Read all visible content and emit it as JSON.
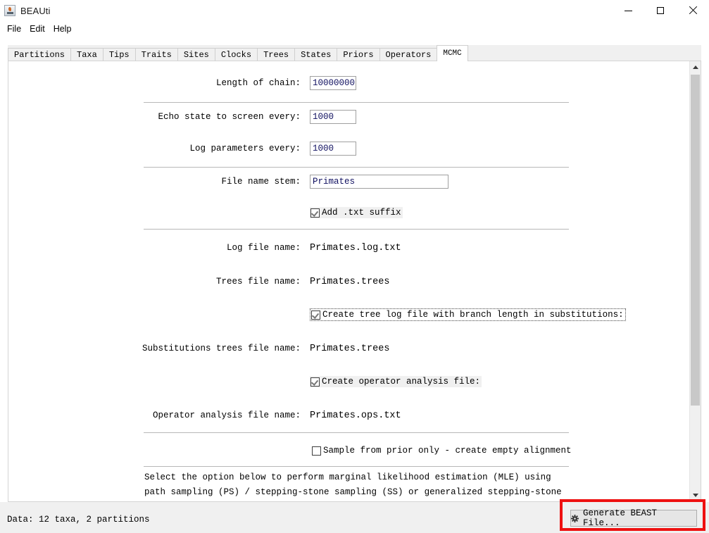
{
  "window": {
    "title": "BEAUti",
    "app_icon": "java-coffee-cup-icon",
    "controls": {
      "minimize": "minimize-icon",
      "maximize": "maximize-icon",
      "close": "close-icon"
    }
  },
  "menubar": {
    "items": [
      {
        "label": "File"
      },
      {
        "label": "Edit"
      },
      {
        "label": "Help"
      }
    ]
  },
  "tabs": [
    {
      "label": "Partitions",
      "active": false
    },
    {
      "label": "Taxa",
      "active": false
    },
    {
      "label": "Tips",
      "active": false
    },
    {
      "label": "Traits",
      "active": false
    },
    {
      "label": "Sites",
      "active": false
    },
    {
      "label": "Clocks",
      "active": false
    },
    {
      "label": "Trees",
      "active": false
    },
    {
      "label": "States",
      "active": false
    },
    {
      "label": "Priors",
      "active": false
    },
    {
      "label": "Operators",
      "active": false
    },
    {
      "label": "MCMC",
      "active": true
    }
  ],
  "form": {
    "length_of_chain": {
      "label": "Length of chain:",
      "value": "10000000"
    },
    "echo_state": {
      "label": "Echo state to screen every:",
      "value": "1000"
    },
    "log_parameters": {
      "label": "Log parameters every:",
      "value": "1000"
    },
    "file_name_stem": {
      "label": "File name stem:",
      "value": "Primates"
    },
    "add_txt_suffix": {
      "label": "Add .txt suffix",
      "checked": true
    },
    "log_file_name": {
      "label": "Log file name:",
      "value": "Primates.log.txt"
    },
    "trees_file_name": {
      "label": "Trees file name:",
      "value": "Primates.trees"
    },
    "create_tree_log_subs": {
      "label": "Create tree log file with branch length in substitutions:",
      "checked": true
    },
    "substitutions_trees_file_name": {
      "label": "Substitutions trees file name:",
      "value": "Primates.trees"
    },
    "create_operator_analysis": {
      "label": "Create operator analysis file:",
      "checked": true
    },
    "operator_analysis_file_name": {
      "label": "Operator analysis file name:",
      "value": "Primates.ops.txt"
    },
    "sample_from_prior": {
      "label": "Sample from prior only - create empty alignment",
      "checked": false
    },
    "mle_paragraph": "Select the option below to perform marginal likelihood estimation (MLE) using path sampling (PS) / stepping-stone sampling (SS) or generalized stepping-stone sampling"
  },
  "scrollbar": {
    "up_arrow": "chevron-up-icon",
    "down_arrow": "chevron-down-icon"
  },
  "statusbar": {
    "data_summary": "Data: 12 taxa, 2 partitions"
  },
  "actions": {
    "generate_button": {
      "label": "Generate BEAST File...",
      "icon": "gear-icon"
    }
  },
  "annotation": {
    "highlight_color": "#ee1111",
    "target": "generate-beast-file-button"
  }
}
